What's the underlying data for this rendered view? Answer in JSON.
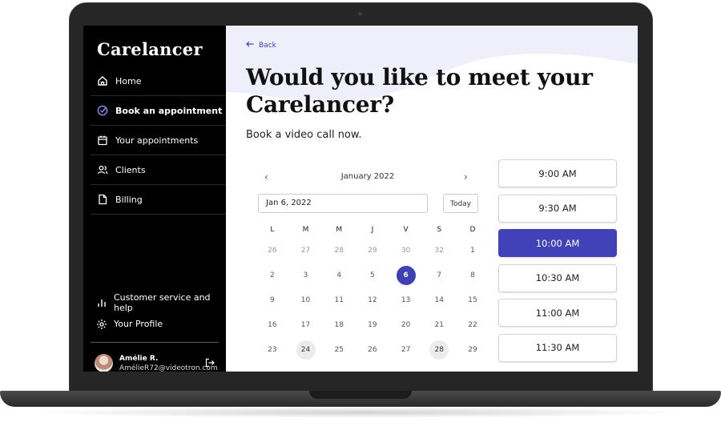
{
  "sidebar": {
    "brand": "Carelancer",
    "nav": [
      {
        "label": "Home",
        "icon": "home-icon"
      },
      {
        "label": "Book an appointment",
        "icon": "check-circle-icon",
        "active": true
      },
      {
        "label": "Your appointments",
        "icon": "calendar-icon"
      },
      {
        "label": "Clients",
        "icon": "users-icon"
      },
      {
        "label": "Billing",
        "icon": "document-icon"
      }
    ],
    "bottom_links": [
      {
        "label": "Customer service and help",
        "icon": "bar-chart-icon"
      },
      {
        "label": "Your Profile",
        "icon": "gear-icon"
      }
    ],
    "user": {
      "name": "Amélie R.",
      "email": "AmélieR72@videotron.com"
    }
  },
  "main": {
    "back_label": "Back",
    "headline": "Would you like to meet your Carelancer?",
    "subtitle": "Book a video call now.",
    "calendar": {
      "month": "January 2022",
      "date_value": "Jan 6, 2022",
      "today_label": "Today",
      "weekdays": [
        "L",
        "M",
        "M",
        "J",
        "V",
        "S",
        "D"
      ],
      "days": [
        [
          "26",
          "27",
          "28",
          "29",
          "30",
          "32",
          "1"
        ],
        [
          "2",
          "3",
          "4",
          "5",
          "6",
          "7",
          "8"
        ],
        [
          "9",
          "10",
          "11",
          "12",
          "13",
          "14",
          "15"
        ],
        [
          "16",
          "17",
          "18",
          "19",
          "20",
          "21",
          "22"
        ],
        [
          "23",
          "24",
          "25",
          "26",
          "27",
          "28",
          "29"
        ]
      ],
      "selected_day": "6"
    },
    "time_slots": [
      "9:00 AM",
      "9:30 AM",
      "10:00 AM",
      "10:30 AM",
      "11:00 AM",
      "11:30 AM"
    ],
    "selected_slot": "10:00 AM"
  },
  "colors": {
    "accent": "#4141b8",
    "sidebar_bg": "#000000",
    "blob": "#efeffb"
  }
}
